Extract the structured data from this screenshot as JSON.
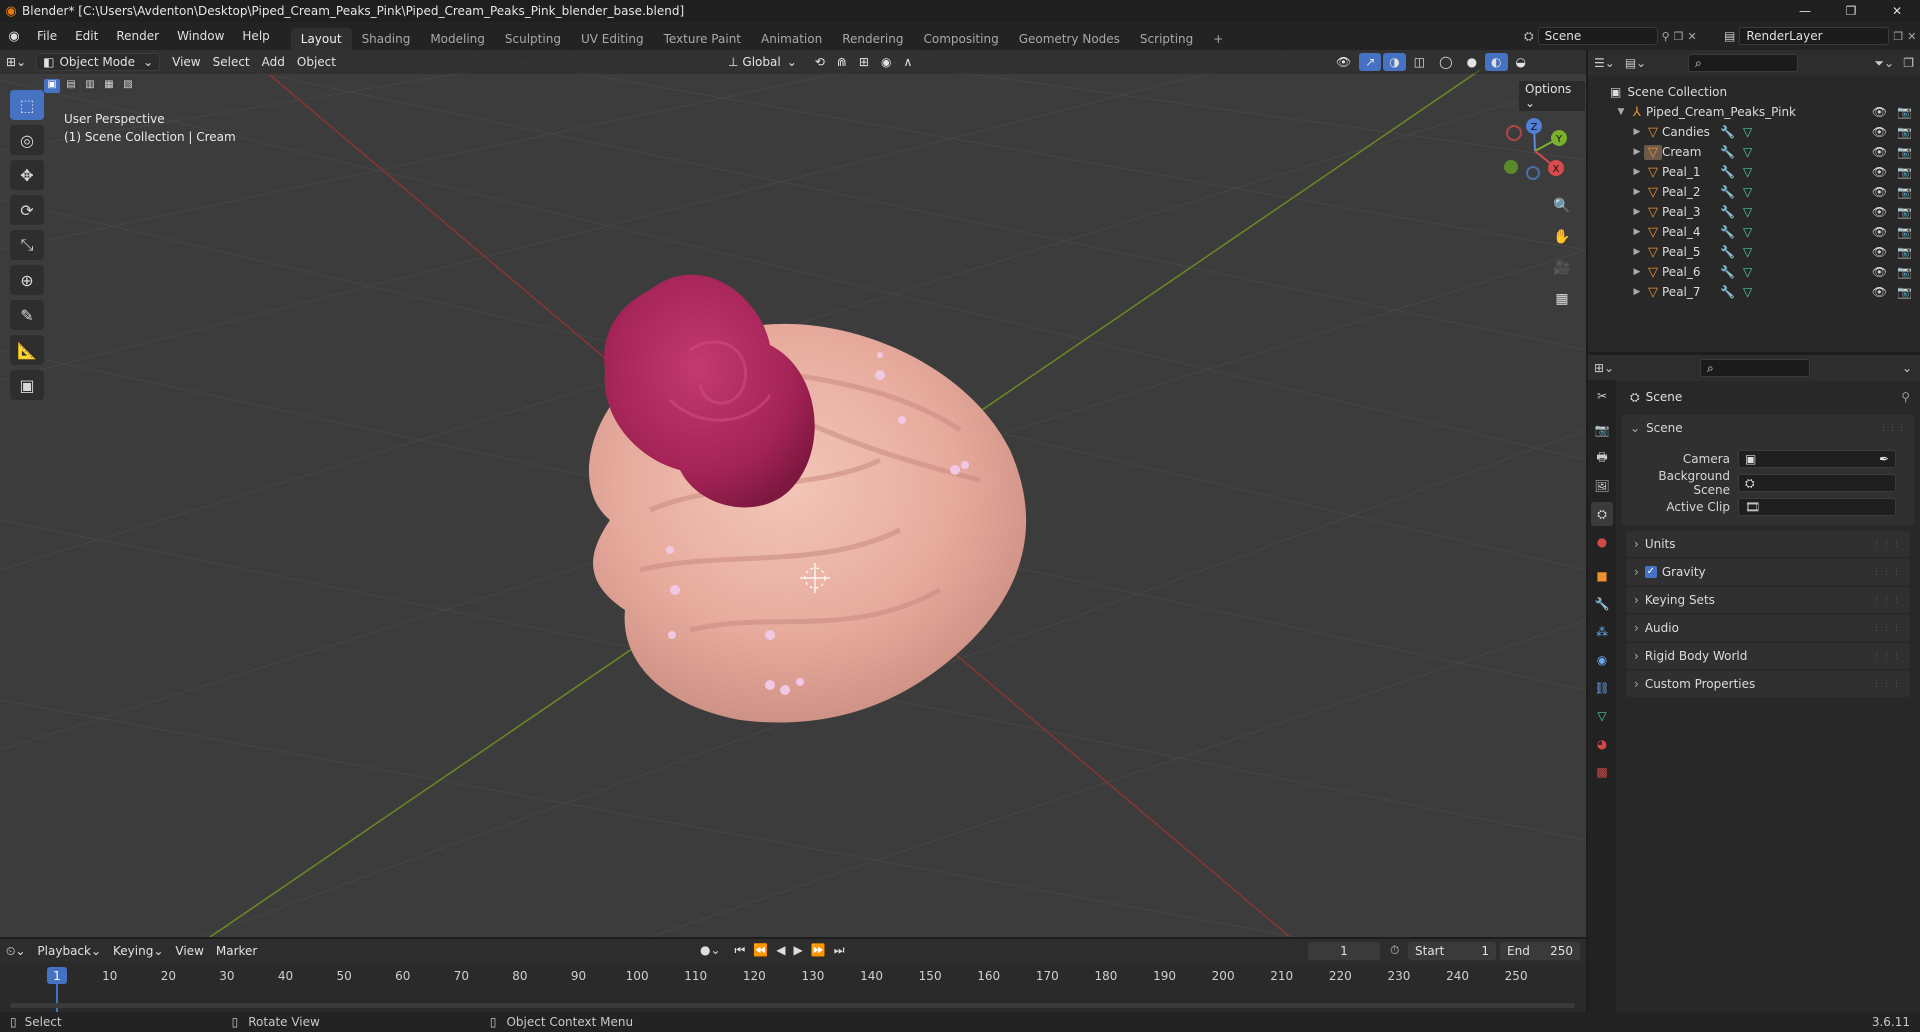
{
  "window": {
    "title": "Blender* [C:\\Users\\Avdenton\\Desktop\\Piped_Cream_Peaks_Pink\\Piped_Cream_Peaks_Pink_blender_base.blend]",
    "controls": [
      "—",
      "❐",
      "✕"
    ]
  },
  "menu": [
    "File",
    "Edit",
    "Render",
    "Window",
    "Help"
  ],
  "workspaces": [
    "Layout",
    "Shading",
    "Modeling",
    "Sculpting",
    "UV Editing",
    "Texture Paint",
    "Animation",
    "Rendering",
    "Compositing",
    "Geometry Nodes",
    "Scripting"
  ],
  "workspace_add": "+",
  "scene_field": "Scene",
  "renderlayer_field": "RenderLayer",
  "viewport_header": {
    "mode": "Object Mode",
    "menus": [
      "View",
      "Select",
      "Add",
      "Object"
    ],
    "transform_orientation": "Global",
    "options": "Options"
  },
  "viewport_overlay": {
    "line1": "User Perspective",
    "line2": "(1) Scene Collection | Cream"
  },
  "gizmo": {
    "z": "Z",
    "y": "Y",
    "x": "X"
  },
  "outliner": {
    "root": "Scene Collection",
    "collection": "Piped_Cream_Peaks_Pink",
    "objects": [
      "Candies",
      "Cream",
      "Peal_1",
      "Peal_2",
      "Peal_3",
      "Peal_4",
      "Peal_5",
      "Peal_6",
      "Peal_7"
    ]
  },
  "properties": {
    "context": "Scene",
    "section": "Scene",
    "fields": [
      {
        "label": "Camera",
        "value": ""
      },
      {
        "label": "Background Scene",
        "value": ""
      },
      {
        "label": "Active Clip",
        "value": ""
      }
    ],
    "panels": [
      "Units",
      "Gravity",
      "Keying Sets",
      "Audio",
      "Rigid Body World",
      "Custom Properties"
    ],
    "gravity_checked": true
  },
  "timeline": {
    "menus": [
      "Playback",
      "Keying",
      "View",
      "Marker"
    ],
    "current_frame": "1",
    "start_label": "Start",
    "start_value": "1",
    "end_label": "End",
    "end_value": "250",
    "ticks": [
      "1",
      "10",
      "20",
      "30",
      "40",
      "50",
      "60",
      "70",
      "80",
      "90",
      "100",
      "110",
      "120",
      "130",
      "140",
      "150",
      "160",
      "170",
      "180",
      "190",
      "200",
      "210",
      "220",
      "230",
      "240",
      "250"
    ]
  },
  "statusbar": {
    "items": [
      "Select",
      "Rotate View",
      "Object Context Menu"
    ],
    "version": "3.6.11"
  },
  "colors": {
    "accent": "#4672c4",
    "object_orange": "#f0912d",
    "mesh_green": "#4fd2a2",
    "cream": "#eab3a6",
    "rose": "#b5285f"
  }
}
